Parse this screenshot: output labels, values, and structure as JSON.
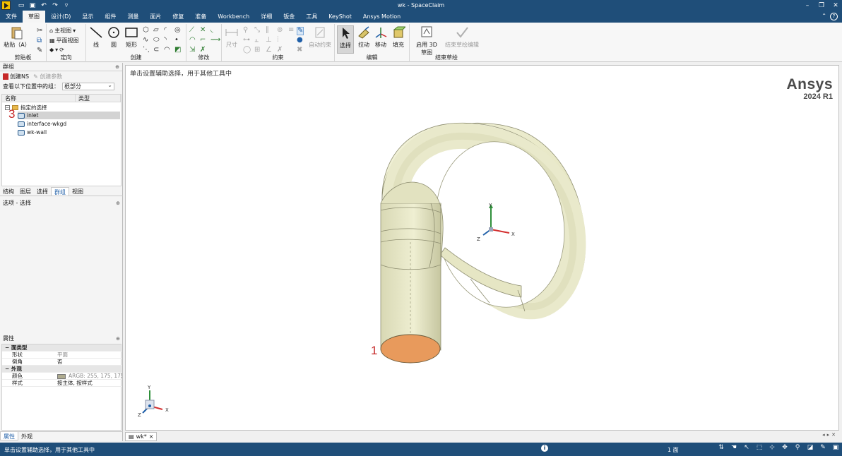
{
  "window": {
    "title": "wk - SpaceClaim"
  },
  "menu": {
    "tabs": [
      "文件",
      "草图",
      "设计(D)",
      "显示",
      "组件",
      "测量",
      "面片",
      "修复",
      "准备",
      "Workbench",
      "详细",
      "钣金",
      "工具",
      "KeyShot",
      "Ansys Motion"
    ],
    "active_index": 1
  },
  "ribbon": {
    "clipboard": {
      "paste": "粘贴（A）",
      "label": "剪贴板"
    },
    "orient": {
      "main_view": "主视图",
      "plane_view": "平面视图",
      "label": "定向"
    },
    "create": {
      "line": "线",
      "circle": "圆",
      "rectangle": "矩形",
      "label": "创建"
    },
    "modify": {
      "label": "修改"
    },
    "constraint": {
      "dimension": "尺寸",
      "auto": "自动约束",
      "label": "约束"
    },
    "edit": {
      "select": "选择",
      "pull": "拉动",
      "move": "移动",
      "fill": "填充",
      "label": "编辑"
    },
    "finish": {
      "enable_3d": "启用 3D 草图",
      "finish_edit": "结束草绘编辑",
      "label": "结束草绘"
    }
  },
  "groups_panel": {
    "title": "群组",
    "create_ns": "创建NS",
    "create_param": "创建参数",
    "view_label": "查看以下位置中的组：",
    "view_value": "根部分",
    "col_name": "名称",
    "col_type": "类型",
    "root": "指定的选择",
    "items": [
      "inlet",
      "interface-wkgd",
      "wk-wall"
    ],
    "selected_index": 0
  },
  "left_tabs": {
    "items": [
      "结构",
      "图层",
      "选择",
      "群组",
      "视图"
    ],
    "active": "群组"
  },
  "options": {
    "title": "选项 - 选择"
  },
  "properties": {
    "title": "属性",
    "rows": [
      {
        "cat": true,
        "k": "面类型",
        "v": ""
      },
      {
        "k": "形状",
        "v": "平面",
        "grey": true
      },
      {
        "k": "倒角",
        "v": "否"
      },
      {
        "cat": true,
        "k": "外观",
        "v": ""
      },
      {
        "k": "颜色",
        "v": "ARGB: 255, 175, 175, 143",
        "grey": true,
        "swatch": true
      },
      {
        "k": "样式",
        "v": "按主体, 按样式"
      }
    ]
  },
  "bottom_tabs": [
    "属性",
    "外观"
  ],
  "viewport": {
    "hint": "单击设置辅助选择，用于其他工具中",
    "brand": "Ansys",
    "version": "2024 R1",
    "axis_x": "X",
    "axis_y": "Y",
    "axis_z": "Z",
    "annot_1": "1",
    "annot_3": "3"
  },
  "doc_tab": {
    "label": "wk*"
  },
  "status": {
    "message": "单击设置辅助选择，用于其他工具中",
    "count": "1 面"
  },
  "colors": {
    "chrome": "#1f4e79",
    "body": "#e8e8c6",
    "selected_face": "#e89a5c"
  }
}
